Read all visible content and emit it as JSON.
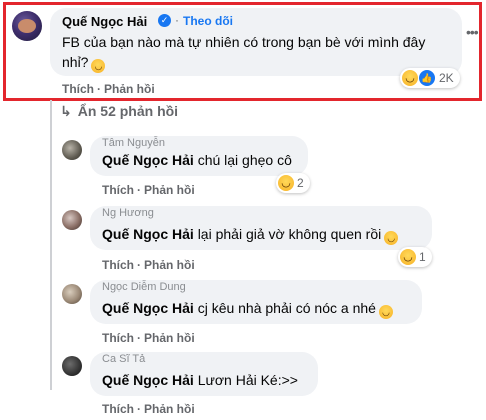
{
  "main_comment": {
    "author": "Quế Ngọc Hải",
    "follow": "Theo dõi",
    "text": "FB của bạn nào mà tự nhiên có trong bạn bè với mình đây nhỉ?",
    "reaction_count": "2K",
    "actions": {
      "like": "Thích",
      "reply": "Phản hồi"
    }
  },
  "expand": {
    "label": "Ẩn 52 phản hồi"
  },
  "replies": [
    {
      "author": "Tâm Nguyễn",
      "mention": "Quế Ngọc Hải",
      "text": "chú lại ghẹo cô",
      "reaction_count": "2",
      "actions": {
        "like": "Thích",
        "reply": "Phản hồi"
      }
    },
    {
      "author": "Ng Hương",
      "mention": "Quế Ngọc Hải",
      "text": "lại phải giả vờ không quen rồi",
      "reaction_count": "1",
      "actions": {
        "like": "Thích",
        "reply": "Phản hồi"
      }
    },
    {
      "author": "Ngọc Diễm Dung",
      "mention": "Quế Ngọc Hải",
      "text": "cj kêu nhà phải có nóc a nhé",
      "actions": {
        "like": "Thích",
        "reply": "Phản hồi"
      }
    },
    {
      "author": "Ca Sĩ Tả",
      "mention": "Quế Ngọc Hải",
      "text": "Lươn Hải Ké:>>",
      "actions": {
        "like": "Thích",
        "reply": "Phản hồi"
      }
    }
  ],
  "icons": {
    "verified": "verified-check-icon",
    "haha": "haha-reaction-icon",
    "like": "like-reaction-icon",
    "more": "more-options-icon"
  },
  "colors": {
    "highlight": "#e3262d",
    "link": "#1877f2",
    "bubble": "#f0f2f5",
    "muted": "#65676b"
  }
}
